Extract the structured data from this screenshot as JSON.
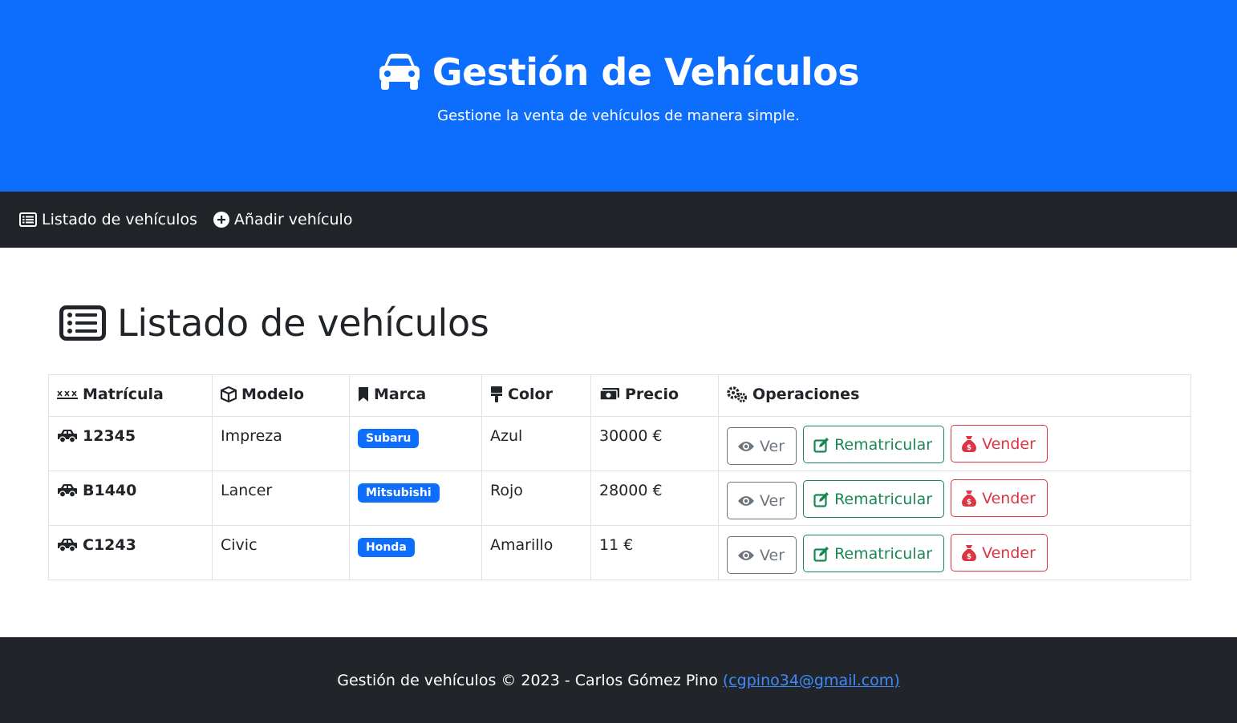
{
  "header": {
    "title": "Gestión de Vehículos",
    "subtitle": "Gestione la venta de vehículos de manera simple.",
    "icon": "car-icon"
  },
  "nav": {
    "items": [
      {
        "label": "Listado de vehículos",
        "icon": "list-icon"
      },
      {
        "label": "Añadir vehículo",
        "icon": "plus-circle-icon"
      }
    ]
  },
  "main": {
    "title": "Listado de vehículos",
    "table": {
      "headers": [
        "Matrícula",
        "Modelo",
        "Marca",
        "Color",
        "Precio",
        "Operaciones"
      ],
      "rows": [
        {
          "plate": "12345",
          "model": "Impreza",
          "brand": "Subaru",
          "color": "Azul",
          "price": "30000 €"
        },
        {
          "plate": "B1440",
          "model": "Lancer",
          "brand": "Mitsubishi",
          "color": "Rojo",
          "price": "28000 €"
        },
        {
          "plate": "C1243",
          "model": "Civic",
          "brand": "Honda",
          "color": "Amarillo",
          "price": "11 €"
        }
      ],
      "actions": {
        "view": "Ver",
        "reregister": "Rematricular",
        "sell": "Vender"
      }
    }
  },
  "footer": {
    "text": "Gestión de vehículos © 2023 - Carlos Gómez Pino",
    "email": "(cgpino34@gmail.com)"
  },
  "colors": {
    "primary": "#0d6efd",
    "dark": "#212529",
    "success": "#198754",
    "danger": "#dc3545",
    "secondary": "#6c757d"
  }
}
